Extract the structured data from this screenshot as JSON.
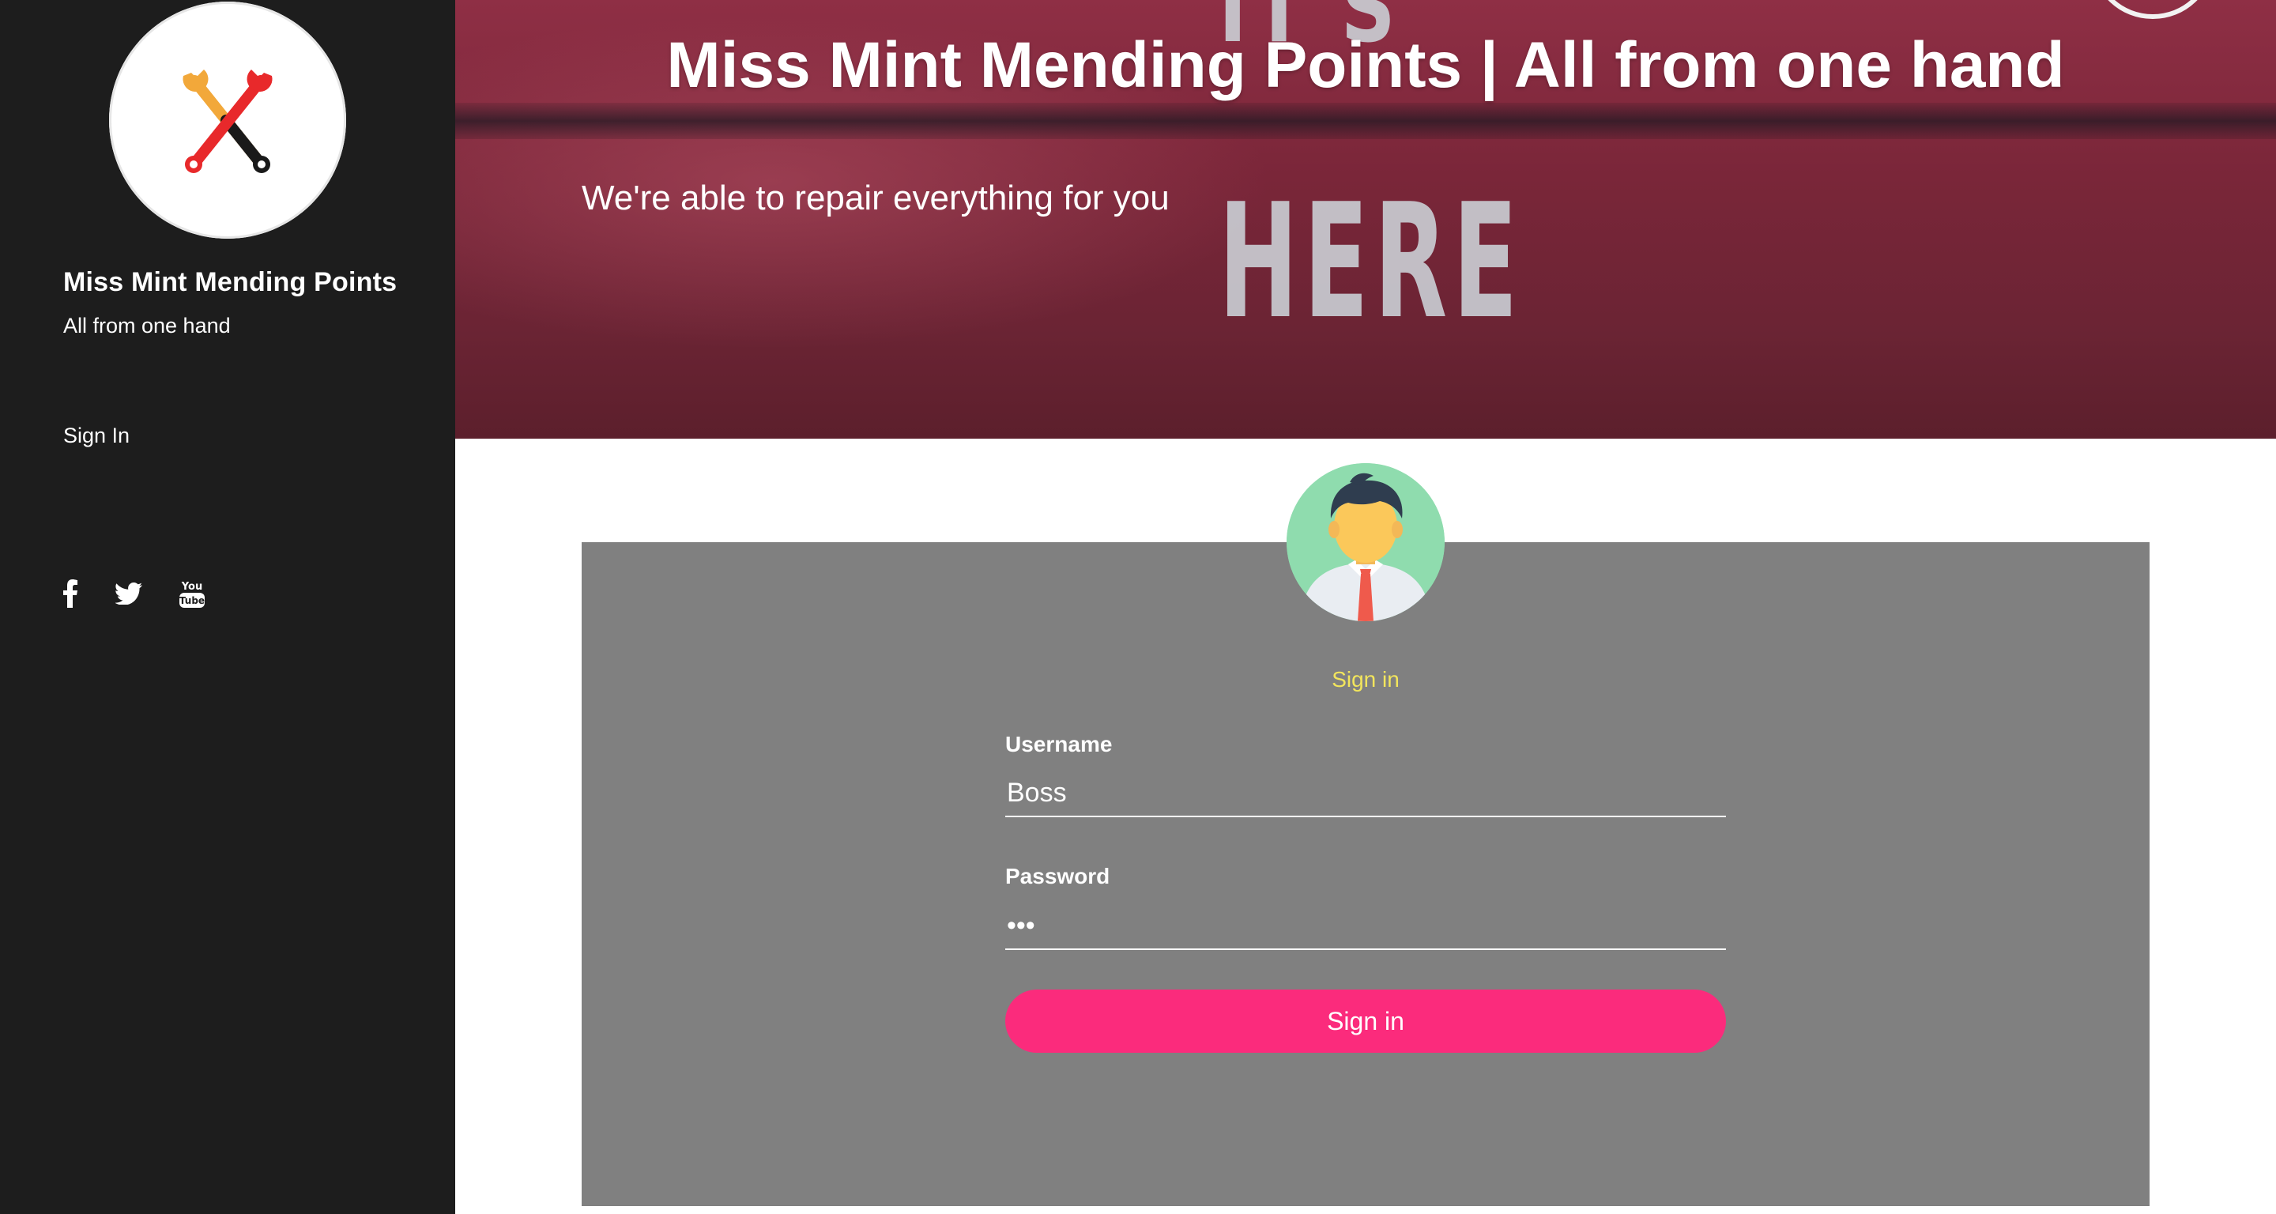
{
  "sidebar": {
    "logo_icon": "crossed-wrenches-icon",
    "site_title": "Miss Mint Mending Points",
    "tagline": "All from one hand",
    "nav": [
      {
        "label": "Sign In"
      }
    ],
    "social": [
      {
        "icon": "facebook-icon"
      },
      {
        "icon": "twitter-icon"
      },
      {
        "icon": "youtube-icon"
      }
    ]
  },
  "header": {
    "title": "Miss Mint Mending Points | All from one hand",
    "subtitle": "We're able to repair everything for you",
    "image_text_top": "IT'S",
    "image_text": "HERE"
  },
  "login": {
    "avatar_icon": "user-avatar-icon",
    "heading": "Sign in",
    "username_label": "Username",
    "username_value": "Boss",
    "password_label": "Password",
    "password_value": "•••",
    "button_label": "Sign in"
  },
  "colors": {
    "sidebar_bg": "#1d1d1d",
    "banner_bg": "#7a2639",
    "panel_bg": "#808080",
    "heading_accent": "#f2e55c",
    "button_bg": "#fb2b7c"
  }
}
